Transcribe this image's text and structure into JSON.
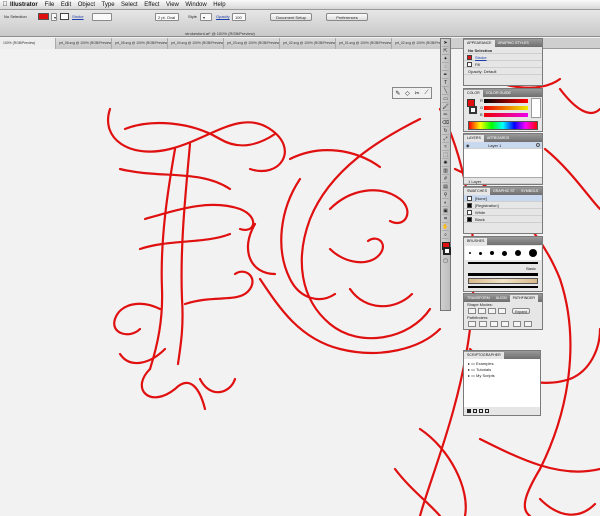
{
  "menubar": {
    "app": "Illustrator",
    "items": [
      "File",
      "Edit",
      "Object",
      "Type",
      "Select",
      "Effect",
      "View",
      "Window",
      "Help"
    ]
  },
  "control": {
    "selection": "No Selection",
    "stroke_label": "Stroke",
    "stroke_weight": "",
    "brush": "2 pt. Oval",
    "style_label": "Style",
    "opacity_label": "Opacity",
    "opacity_value": "100",
    "document_setup": "Document Setup",
    "preferences": "Preferences"
  },
  "document": {
    "title": "strokesfont.ai* @ 100% (RGB/Preview)"
  },
  "tabs": [
    "100% (RGB/Preview)",
    "prt_06.svg @ 100% (RGB/Preview)",
    "prt_05.svg @ 100% (RGB/Preview)",
    "prt_04.svg @ 100% (RGB/Preview)",
    "prt_03.svg @ 100% (RGB/Preview)",
    "prt_02.svg @ 100% (RGB/Preview)",
    "prt_01.svg @ 100% (RGB/Preview)",
    "prt_02.svg @ 100% (RGB/Preview)"
  ],
  "appearance": {
    "tabs": [
      "APPEARANCE",
      "GRAPHIC STYLES"
    ],
    "title": "No Selection",
    "rows": [
      "Stroke",
      "Fill",
      "Opacity: Default"
    ]
  },
  "color": {
    "tabs": [
      "COLOR",
      "COLOR GUIDE"
    ],
    "channels": [
      "R",
      "G",
      "B"
    ]
  },
  "layers": {
    "tabs": [
      "LAYERS",
      "ARTBOARDS"
    ],
    "rows": [
      "Layer 1"
    ],
    "footer": "1 Layer"
  },
  "swatches": {
    "tabs": [
      "SWATCHES",
      "GRAPHIC ST",
      "SYMBOLS"
    ],
    "rows": [
      "[None]",
      "[Registration]",
      "White",
      "Black"
    ]
  },
  "brushes": {
    "tabs": [
      "BRUSHES"
    ],
    "label": "Basic"
  },
  "pathfinder": {
    "tabs": [
      "TRANSFORM",
      "ALIGN",
      "PATHFINDER"
    ],
    "shape_modes": "Shape Modes:",
    "pathfinders": "Pathfinders:",
    "expand": "Expand"
  },
  "scriptographer": {
    "tabs": [
      "SCRIPTOGRAPHER"
    ],
    "items": [
      "Examples",
      "Tutorials",
      "My Scripts"
    ]
  },
  "colors": {
    "accent": "#e01010",
    "panel_header": "#7a7a7a"
  }
}
